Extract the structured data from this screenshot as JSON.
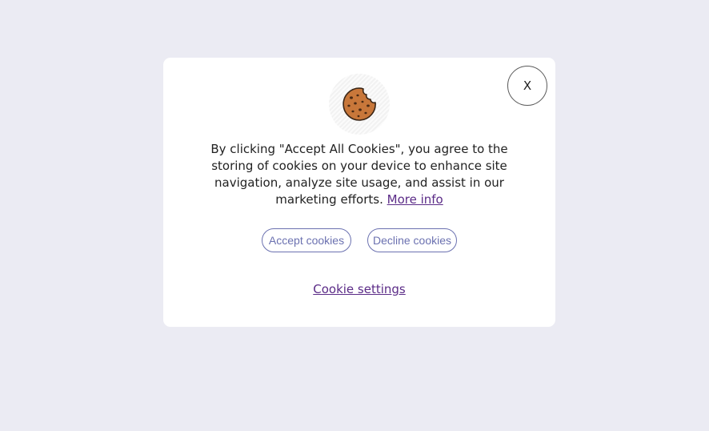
{
  "modal": {
    "close_label": "X",
    "message_text": "By clicking \"Accept All Cookies\", you agree to the storing of cookies on your device to enhance site navigation, analyze site usage, and assist in our marketing efforts.",
    "more_info_label": "More info",
    "accept_label": "Accept cookies",
    "decline_label": "Decline cookies",
    "settings_label": "Cookie settings",
    "icon": "cookie-icon"
  },
  "colors": {
    "page_background": "#ebebf3",
    "button_accent": "#6b71b0",
    "link": "#5b2b87",
    "cookie": "#c8773a"
  }
}
